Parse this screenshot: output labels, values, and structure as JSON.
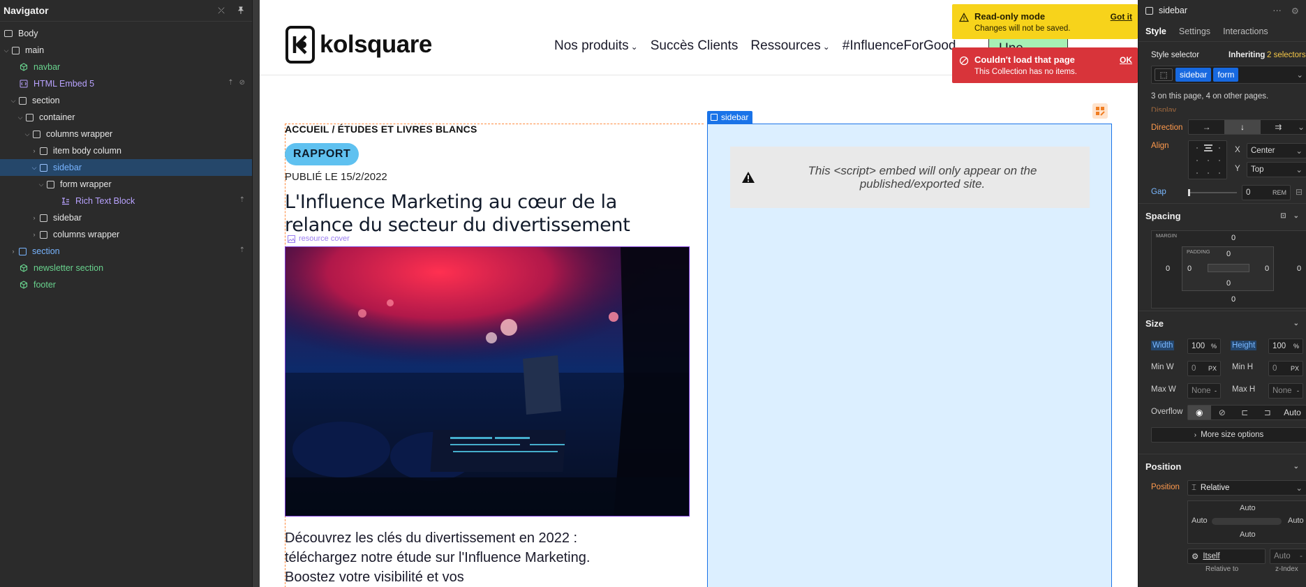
{
  "navigator": {
    "title": "Navigator",
    "items": [
      {
        "label": "Body"
      },
      {
        "label": "main"
      },
      {
        "label": "navbar"
      },
      {
        "label": "HTML Embed 5"
      },
      {
        "label": "section"
      },
      {
        "label": "container"
      },
      {
        "label": "columns wrapper"
      },
      {
        "label": "item body column"
      },
      {
        "label": "sidebar"
      },
      {
        "label": "form wrapper"
      },
      {
        "label": "Rich Text Block"
      },
      {
        "label": "sidebar"
      },
      {
        "label": "columns wrapper"
      },
      {
        "label": "section"
      },
      {
        "label": "newsletter section"
      },
      {
        "label": "footer"
      }
    ]
  },
  "site": {
    "logo_text": "kolsquare",
    "menu": [
      "Nos produits",
      "Succès Clients",
      "Ressources",
      "#InfluenceForGood"
    ],
    "demo_label": "Une démo?",
    "breadcrumb": "ACCUEIL / ÉTUDES ET LIVRES BLANCS",
    "tag": "RAPPORT",
    "published": "PUBLIÉ LE 15/2/2022",
    "title": "L'Influence Marketing au cœur de la relance du secteur du divertissement",
    "cover_label": "resource cover",
    "body_text": "Découvrez les clés du divertissement en 2022 : téléchargez notre étude sur l'Influence Marketing. Boostez votre visibilité et vos"
  },
  "sidebar_canvas": {
    "label": "sidebar",
    "embed_message": "This <script> embed will only appear on the published/exported site."
  },
  "toasts": {
    "readonly": {
      "title": "Read-only mode",
      "text": "Changes will not be saved.",
      "button": "Got it"
    },
    "error": {
      "title": "Couldn't load that page",
      "text": "This Collection has no items.",
      "button": "OK"
    }
  },
  "panel": {
    "selected": "sidebar",
    "tabs": [
      "Style",
      "Settings",
      "Interactions"
    ],
    "style_selector_label": "Style selector",
    "inheriting_text": "Inheriting",
    "inheriting_count": "2 selectors",
    "selector_pills": [
      "sidebar",
      "form"
    ],
    "selector_info": "3 on this page, 4 on other pages.",
    "display_label": "Display",
    "direction_label": "Direction",
    "align_label": "Align",
    "align_x_label": "X",
    "align_x_value": "Center",
    "align_y_label": "Y",
    "align_y_value": "Top",
    "gap_label": "Gap",
    "gap_value": "0",
    "gap_unit": "REM",
    "spacing_title": "Spacing",
    "margin_label": "MARGIN",
    "padding_label": "PADDING",
    "margin": {
      "top": "0",
      "right": "0",
      "bottom": "0",
      "left": "0"
    },
    "padding": {
      "top": "0",
      "right": "0",
      "bottom": "0",
      "left": "0"
    },
    "size_title": "Size",
    "width_label": "Width",
    "width_value": "100",
    "width_unit": "%",
    "height_label": "Height",
    "height_value": "100",
    "height_unit": "%",
    "minw_label": "Min W",
    "minw_value": "0",
    "minw_unit": "PX",
    "minh_label": "Min H",
    "minh_value": "0",
    "minh_unit": "PX",
    "maxw_label": "Max W",
    "maxw_value": "None",
    "maxw_unit": "-",
    "maxh_label": "Max H",
    "maxh_value": "None",
    "maxh_unit": "-",
    "overflow_label": "Overflow",
    "overflow_auto": "Auto",
    "more_size": "More size options",
    "position_title": "Position",
    "position_label": "Position",
    "position_value": "Relative",
    "pos_top": "Auto",
    "pos_left": "Auto",
    "pos_right": "Auto",
    "pos_bottom": "Auto",
    "relative_to": "Itself",
    "zindex_value": "Auto",
    "relative_to_label": "Relative to",
    "zindex_label": "z-Index"
  },
  "colors": {
    "accent": "#1769e0",
    "warning": "#f7d31b",
    "error": "#d8343a",
    "tag": "#5fc1f0",
    "selected_row": "#25476a"
  }
}
